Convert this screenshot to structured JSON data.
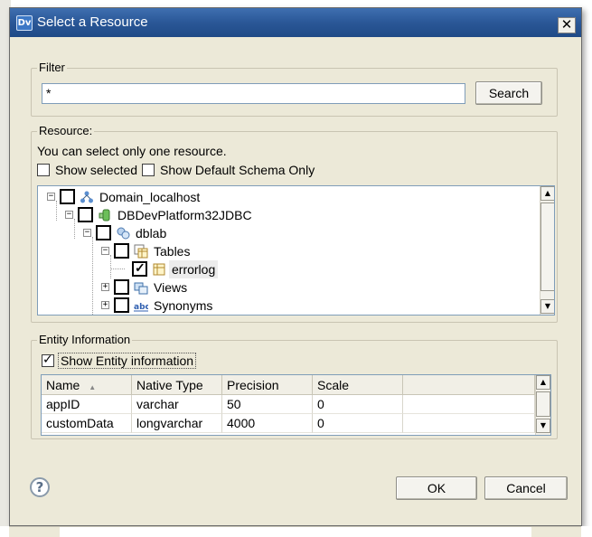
{
  "window": {
    "title": "Select a Resource",
    "app_icon": "Dv"
  },
  "filter": {
    "legend": "Filter",
    "value": "*",
    "search_label": "Search"
  },
  "resource": {
    "legend": "Resource:",
    "hint": "You can select only one resource.",
    "show_selected_label": "Show selected",
    "show_default_schema_label": "Show Default Schema Only",
    "tree": [
      {
        "label": "Domain_localhost",
        "icon": "domain-icon",
        "checked": false,
        "expander": "⊟"
      },
      {
        "label": "DBDevPlatform32JDBC",
        "icon": "database-icon",
        "checked": false,
        "expander": "⊟"
      },
      {
        "label": "dblab",
        "icon": "schema-icon",
        "checked": false,
        "expander": "⊟"
      },
      {
        "label": "Tables",
        "icon": "tables-icon",
        "checked": false,
        "expander": "⊟"
      },
      {
        "label": "errorlog",
        "icon": "table-icon",
        "checked": true,
        "expander": ""
      },
      {
        "label": "Views",
        "icon": "views-icon",
        "checked": false,
        "expander": "⊞"
      },
      {
        "label": "Synonyms",
        "icon": "synonyms-icon",
        "checked": false,
        "expander": "⊞"
      }
    ]
  },
  "entity": {
    "legend": "Entity Information",
    "show_entity_label": "Show Entity information",
    "show_entity_checked": true,
    "columns": [
      "Name",
      "Native Type",
      "Precision",
      "Scale"
    ],
    "rows": [
      [
        "appID",
        "varchar",
        "50",
        "0"
      ],
      [
        "customData",
        "longvarchar",
        "4000",
        "0"
      ]
    ]
  },
  "footer": {
    "help_icon": "help-icon",
    "ok_label": "OK",
    "cancel_label": "Cancel"
  },
  "colors": {
    "title_bar": "#2a5797",
    "dialog_bg": "#ece9d8",
    "selected_row_bg": "#ececec"
  }
}
